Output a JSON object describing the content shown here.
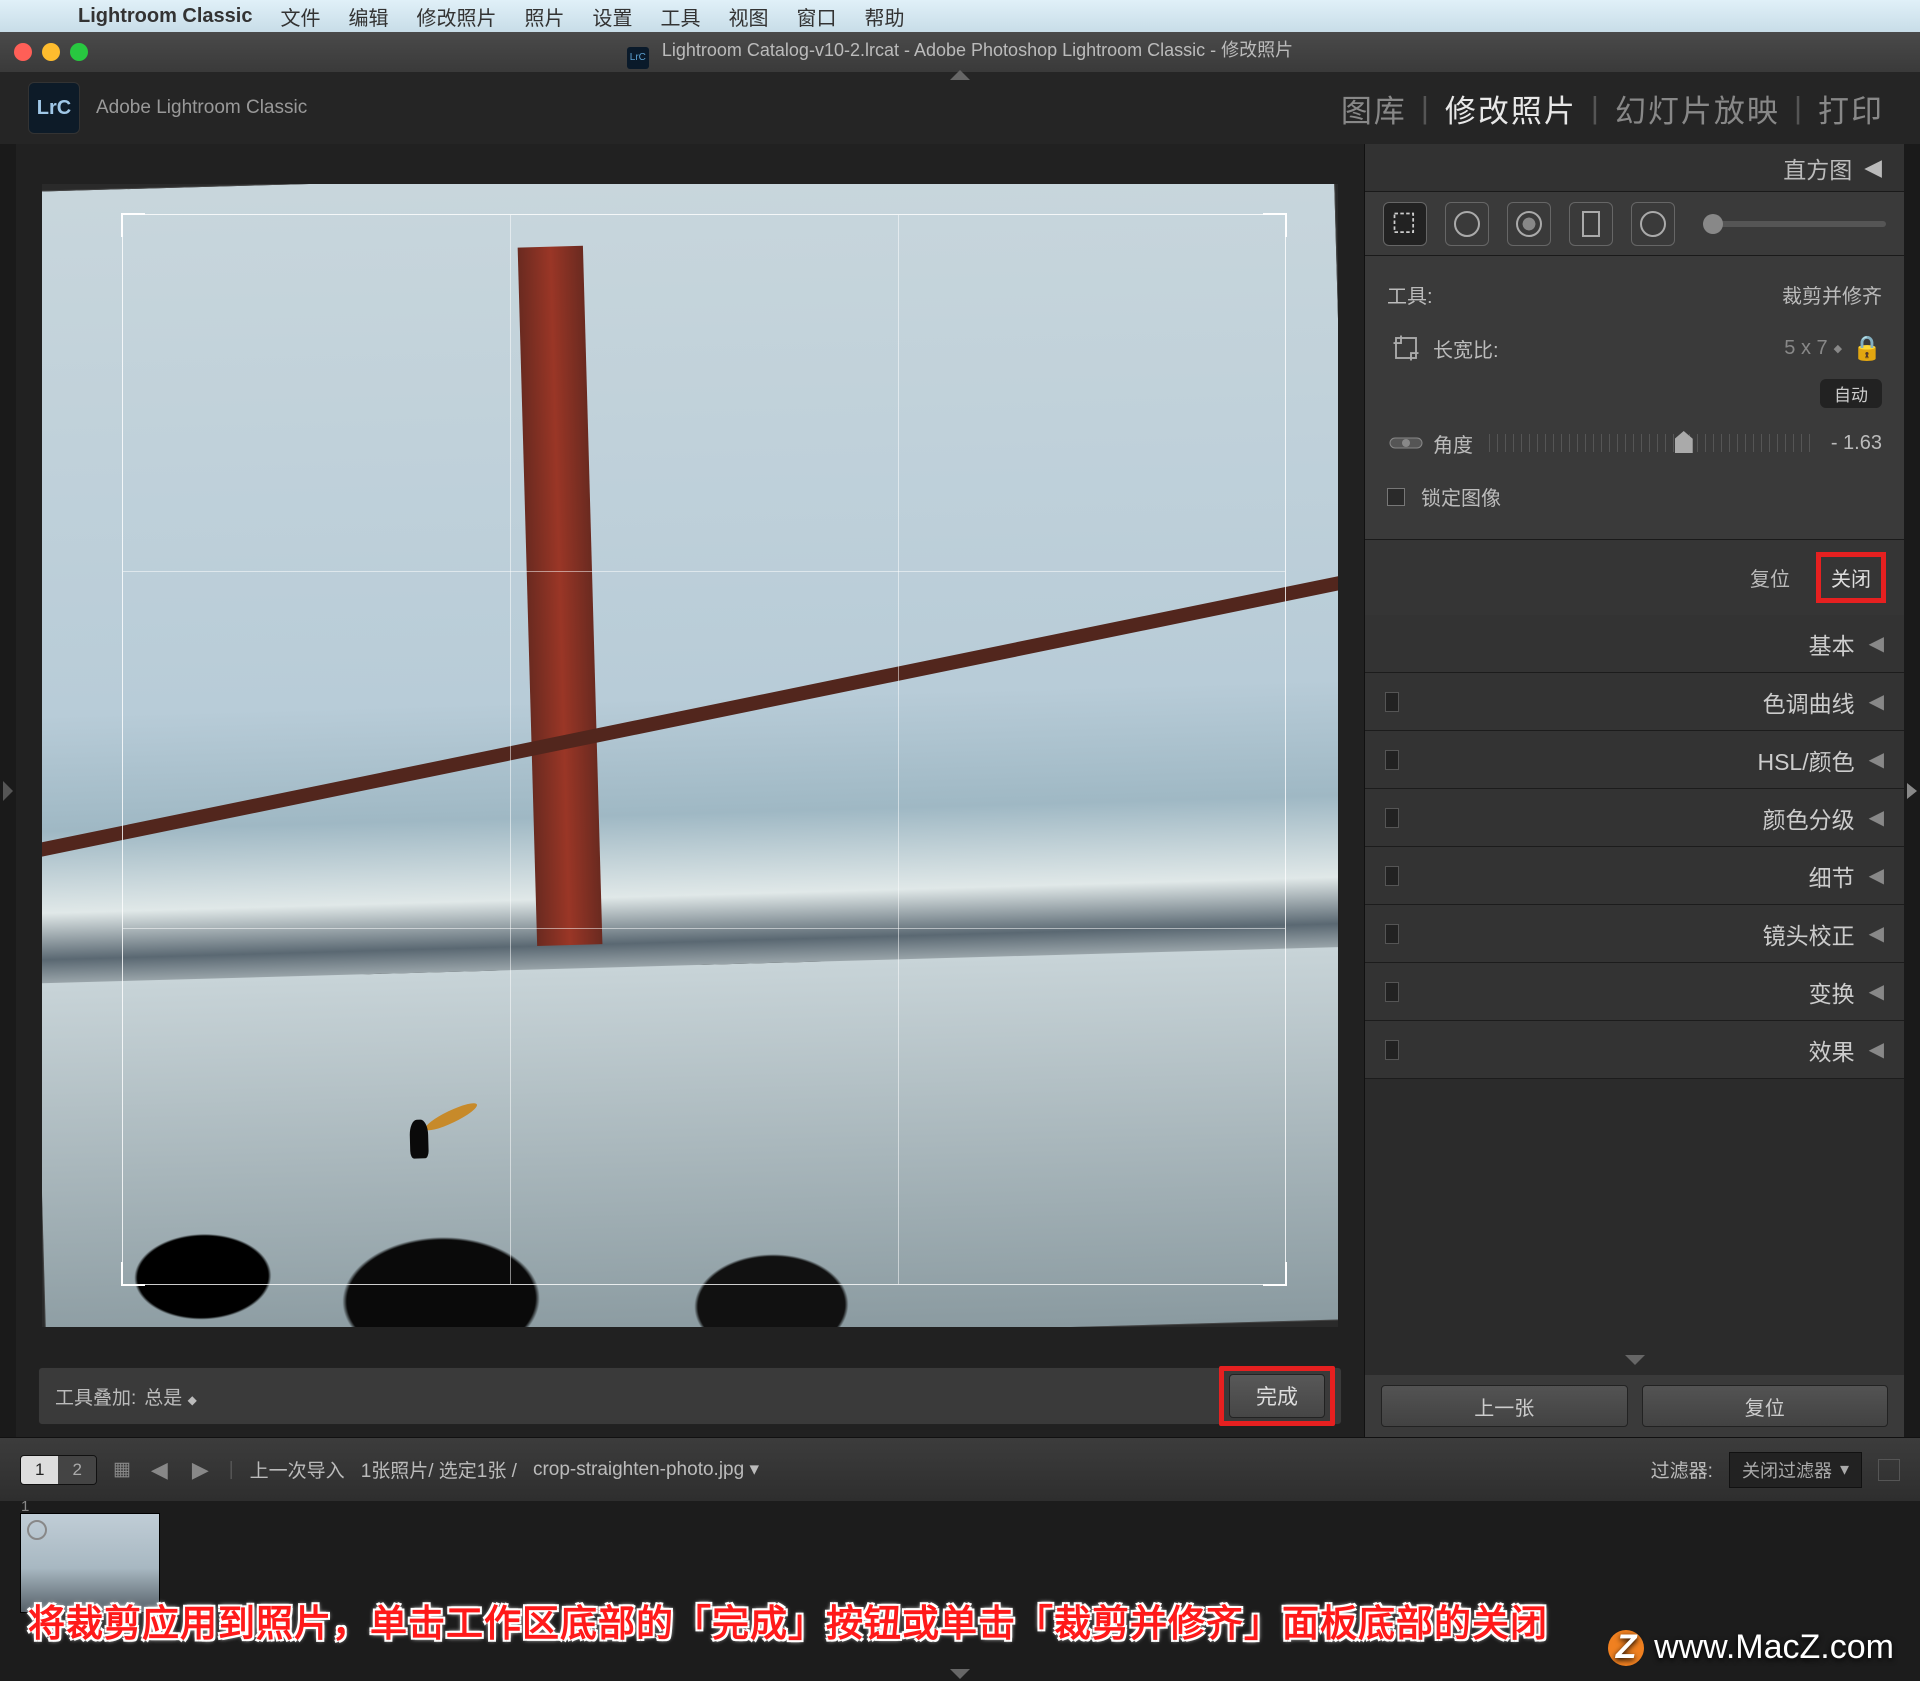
{
  "menubar": {
    "app_name": "Lightroom Classic",
    "items": [
      "文件",
      "编辑",
      "修改照片",
      "照片",
      "设置",
      "工具",
      "视图",
      "窗口",
      "帮助"
    ]
  },
  "titlebar": {
    "text": "Lightroom Catalog-v10-2.lrcat - Adobe Photoshop Lightroom Classic - 修改照片",
    "badge": "LrC"
  },
  "header": {
    "logo_text": "LrC",
    "product": "Adobe Lightroom Classic",
    "modules": {
      "library": "图库",
      "develop": "修改照片",
      "slideshow": "幻灯片放映",
      "print": "打印"
    }
  },
  "canvas": {
    "tool_overlay_label": "工具叠加:",
    "tool_overlay_value": "总是",
    "done": "完成"
  },
  "right": {
    "histogram": "直方图",
    "tools_label": "工具:",
    "tools_value": "裁剪并修齐",
    "aspect_label": "长宽比:",
    "aspect_value": "5 x 7",
    "auto": "自动",
    "angle_label": "角度",
    "angle_value": "- 1.63",
    "lock_image": "锁定图像",
    "reset": "复位",
    "close": "关闭",
    "sections": [
      "基本",
      "色调曲线",
      "HSL/颜色",
      "颜色分级",
      "细节",
      "镜头校正",
      "变换",
      "效果"
    ],
    "prev": "上一张",
    "reset2": "复位"
  },
  "filmstrip_header": {
    "view1": "1",
    "view2": "2",
    "context": "上一次导入",
    "count": "1张照片/ 选定1张 /",
    "filename": "crop-straighten-photo.jpg",
    "filter_label": "过滤器:",
    "filter_value": "关闭过滤器"
  },
  "thumb_index": "1",
  "annotation": "将裁剪应用到照片，单击工作区底部的「完成」按钮或单击「裁剪并修齐」面板底部的关闭",
  "watermark": "www.MacZ.com"
}
